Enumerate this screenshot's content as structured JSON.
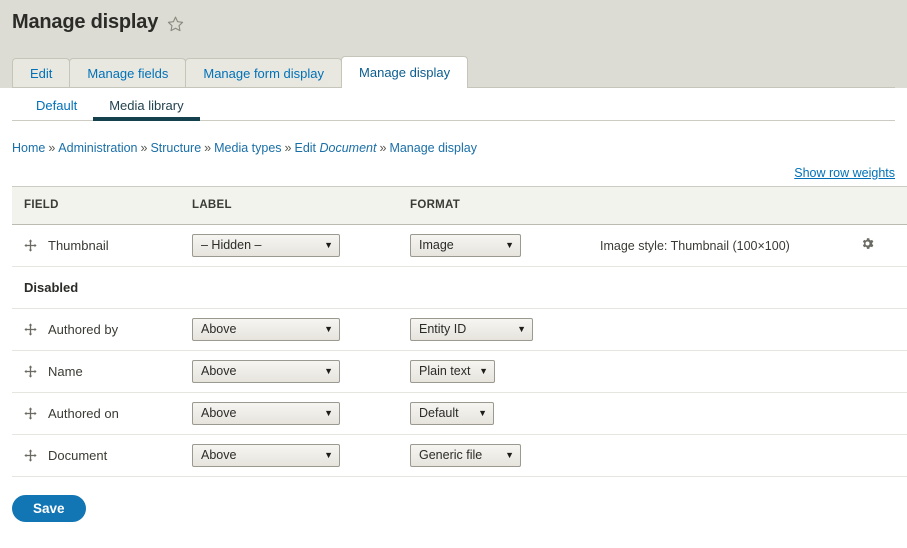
{
  "header": {
    "title": "Manage display",
    "star_icon": "star-outline-icon"
  },
  "primary_tabs": [
    {
      "label": "Edit",
      "active": false
    },
    {
      "label": "Manage fields",
      "active": false
    },
    {
      "label": "Manage form display",
      "active": false
    },
    {
      "label": "Manage display",
      "active": true
    }
  ],
  "secondary_tabs": [
    {
      "label": "Default",
      "active": false
    },
    {
      "label": "Media library",
      "active": true
    }
  ],
  "breadcrumb": {
    "items": [
      {
        "text": "Home",
        "italic": false
      },
      {
        "text": "Administration",
        "italic": false
      },
      {
        "text": "Structure",
        "italic": false
      },
      {
        "text": "Media types",
        "italic": false
      },
      {
        "text": "Edit ",
        "italic": false,
        "suffix_italic": "Document"
      },
      {
        "text": "Manage display",
        "italic": false
      }
    ],
    "separator": "»"
  },
  "row_weights": {
    "link_label": "Show row weights"
  },
  "table": {
    "columns": [
      "FIELD",
      "LABEL",
      "FORMAT"
    ],
    "rows": [
      {
        "field": "Thumbnail",
        "label_value": "– Hidden –",
        "format_value": "Image",
        "summary": "Image style: Thumbnail (100×100)",
        "has_gear": true,
        "drag_icon": "move-handle-icon",
        "gear_icon": "gear-icon"
      }
    ],
    "region_title": "Disabled",
    "disabled_rows": [
      {
        "field": "Authored by",
        "label_value": "Above",
        "format_value": "Entity ID",
        "drag_icon": "move-handle-icon"
      },
      {
        "field": "Name",
        "label_value": "Above",
        "format_value": "Plain text",
        "drag_icon": "move-handle-icon"
      },
      {
        "field": "Authored on",
        "label_value": "Above",
        "format_value": "Default",
        "drag_icon": "move-handle-icon"
      },
      {
        "field": "Document",
        "label_value": "Above",
        "format_value": "Generic file",
        "drag_icon": "move-handle-icon"
      }
    ]
  },
  "actions": {
    "save_label": "Save"
  },
  "colors": {
    "header_band": "#dcdcd4",
    "link": "#0071b8",
    "active_tab_underline": "#15414f",
    "save_button": "#1275b4",
    "table_header_bg": "#f3f3ee"
  }
}
